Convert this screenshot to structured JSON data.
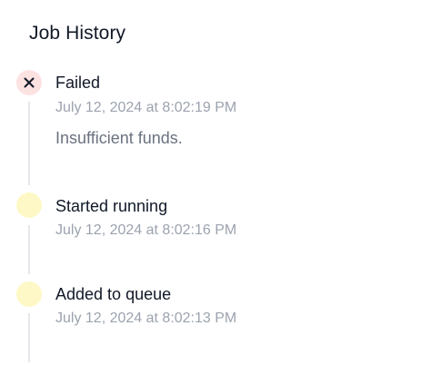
{
  "header": {
    "title": "Job History"
  },
  "events": [
    {
      "status": "failed",
      "icon": "close-icon",
      "title": "Failed",
      "timestamp": "July 12, 2024 at 8:02:19 PM",
      "detail": "Insufficient funds.",
      "color": "#fde2e2"
    },
    {
      "status": "running",
      "icon": "none",
      "title": "Started running",
      "timestamp": "July 12, 2024 at 8:02:16 PM",
      "color": "#fef8c6"
    },
    {
      "status": "queued",
      "icon": "none",
      "title": "Added to queue",
      "timestamp": "July 12, 2024 at 8:02:13 PM",
      "color": "#fef8c6"
    }
  ]
}
